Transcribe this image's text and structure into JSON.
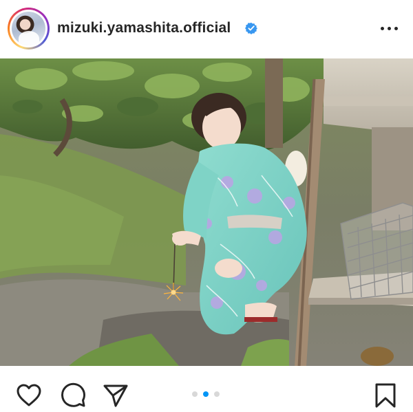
{
  "post": {
    "username": "mizuki.yamashita.official",
    "verified": true,
    "icons": {
      "avatar": "profile-avatar",
      "verified": "verified-badge-icon",
      "more": "more-options-icon",
      "like": "heart-icon",
      "comment": "comment-icon",
      "share": "send-icon",
      "save": "bookmark-icon"
    },
    "carousel": {
      "total": 3,
      "active_index": 1
    },
    "colors": {
      "accent": "#0095f6",
      "text": "#262626",
      "inactive_dot": "#d8d8d8"
    }
  }
}
